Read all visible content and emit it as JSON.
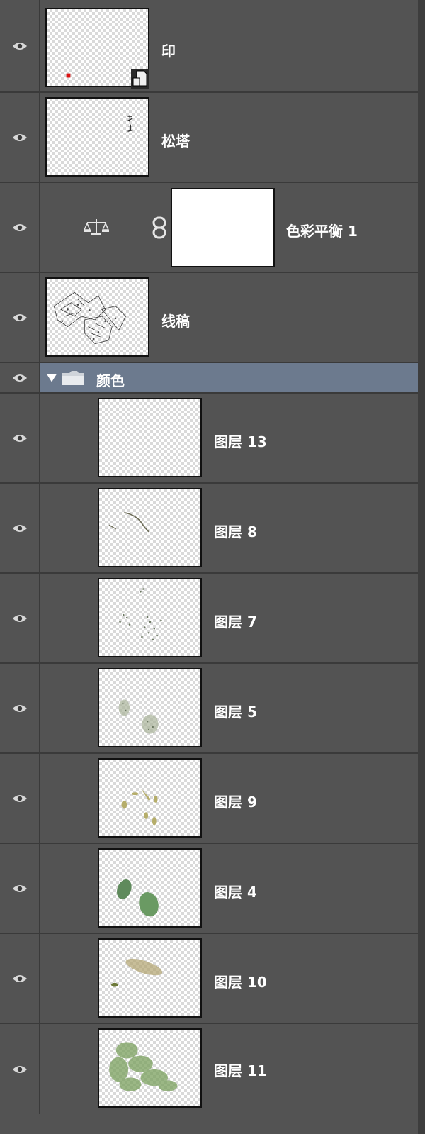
{
  "layers": [
    {
      "id": "yin",
      "label": "印"
    },
    {
      "id": "songta",
      "label": "松塔"
    },
    {
      "id": "adjust",
      "label": "色彩平衡 1"
    },
    {
      "id": "xiangao",
      "label": "线稿"
    },
    {
      "id": "group",
      "label": "颜色"
    },
    {
      "id": "l13",
      "label": "图层 13"
    },
    {
      "id": "l8",
      "label": "图层 8"
    },
    {
      "id": "l7",
      "label": "图层 7"
    },
    {
      "id": "l5",
      "label": "图层 5"
    },
    {
      "id": "l9",
      "label": "图层 9"
    },
    {
      "id": "l4",
      "label": "图层 4"
    },
    {
      "id": "l10",
      "label": "图层 10"
    },
    {
      "id": "l11",
      "label": "图层 11"
    }
  ],
  "icons": {
    "visibility": "eye-icon",
    "smart_object": "smart-object-badge-icon",
    "color_balance": "scale-balance-icon",
    "mask_link": "chain-link-icon",
    "group_toggle": "triangle-down-icon",
    "group_folder": "folder-icon"
  },
  "colors": {
    "panel_bg": "#535353",
    "group_highlight": "#6c7a8e",
    "separator": "#3a3a3a"
  }
}
